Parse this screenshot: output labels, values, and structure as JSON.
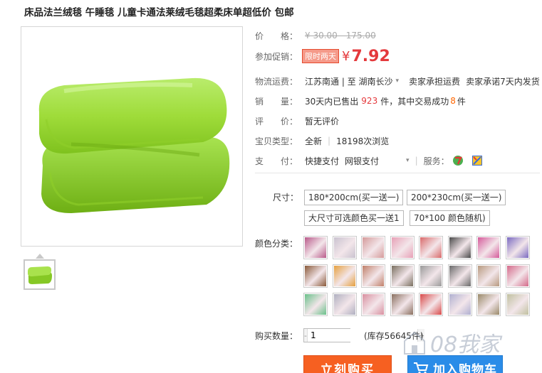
{
  "title": "床品法兰绒毯 午睡毯 儿童卡通法莱绒毛毯超柔床单超低价 包邮",
  "price": {
    "label": "价　　格：",
    "original": "¥ 30.00 - 175.00"
  },
  "promo": {
    "label": "参加促销：",
    "badge": "限时两天",
    "currency": "¥",
    "value": "7.92"
  },
  "logistics": {
    "label": "物流运费：",
    "route": "江苏南通 | 至  湖南长沙",
    "seller_pays": "卖家承担运费",
    "promise": "卖家承诺7天内发货"
  },
  "sales": {
    "label": "销　　量：",
    "prefix": "30天内已售出",
    "sold": "923",
    "middle": "件，其中交易成功",
    "success": "8",
    "suffix": "件"
  },
  "review": {
    "label": "评　　价：",
    "value": "暂无评价"
  },
  "item_type": {
    "label": "宝贝类型：",
    "condition": "全新",
    "views": "18198次浏览"
  },
  "payment": {
    "label": "支　　付：",
    "method1": "快捷支付",
    "method2": "网银支付",
    "service_label": "服务："
  },
  "size": {
    "label": "尺寸：",
    "options": [
      "180*200cm(买一送一)",
      "200*230cm(买一送一)",
      "大尺寸可选颜色买一送1",
      "70*100 颜色随机)"
    ]
  },
  "color": {
    "label": "颜色分类：",
    "swatches": [
      "#b85a8a",
      "#c9c2cf",
      "#d49a9a",
      "#e7a0b6",
      "#d86a6a",
      "#4a4a4a",
      "#d45a9a",
      "#7a6ac0",
      "#8a5a3a",
      "#e5a040",
      "#c0806a",
      "#7a7060",
      "#9a9a9a",
      "#6a6a6a",
      "#b89a80",
      "#d46a8a",
      "#6ac08a",
      "#b0b0c0",
      "#d890a0",
      "#8a7060",
      "#d84a4a",
      "#b0b0d0",
      "#9a8a6a",
      "#c0c0a0"
    ]
  },
  "quantity": {
    "label": "购买数量：",
    "minus": "-",
    "value": "1",
    "plus": "+",
    "stock": "(库存56645件)"
  },
  "actions": {
    "buy": "立刻购买",
    "cart": "加入购物车"
  },
  "watermark": "08我家"
}
